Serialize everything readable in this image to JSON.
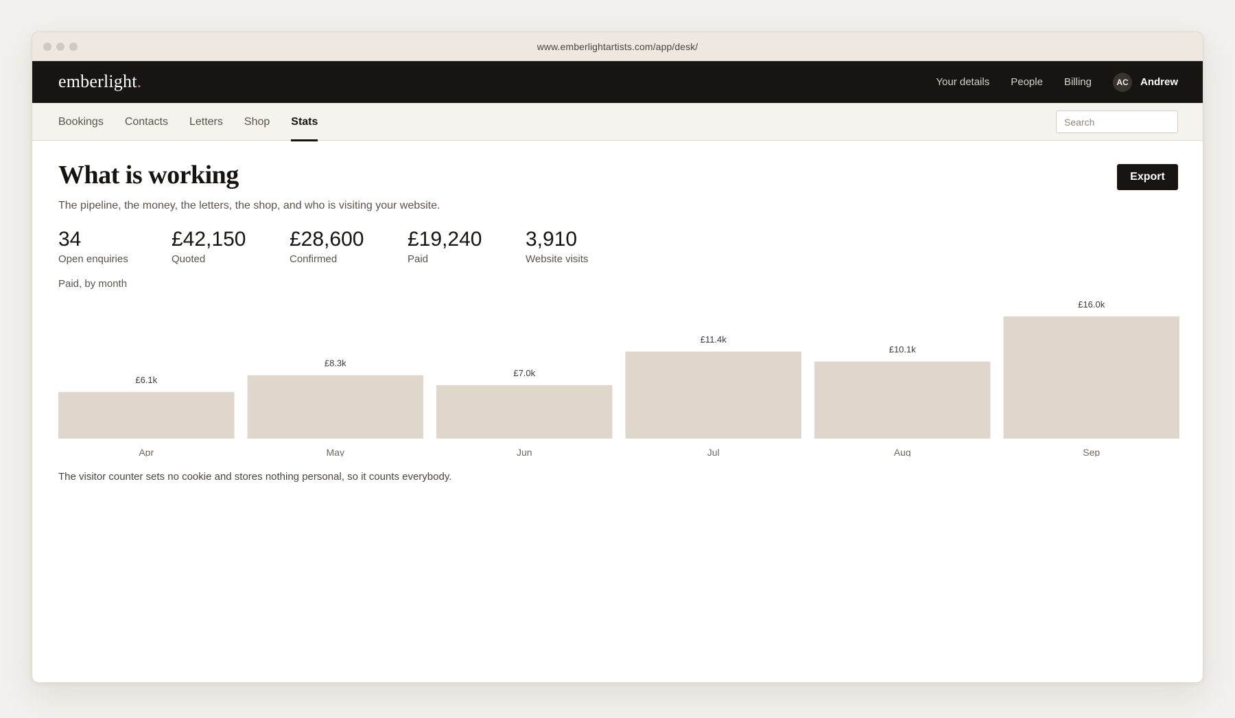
{
  "browser": {
    "url": "www.emberlightartists.com/app/desk/"
  },
  "topbar": {
    "logo": "emberlight",
    "logo_dot": ".",
    "links": [
      "Your details",
      "People",
      "Billing"
    ],
    "user": {
      "initials": "AC",
      "name": "Andrew"
    }
  },
  "subnav": {
    "tabs": [
      "Bookings",
      "Contacts",
      "Letters",
      "Shop",
      "Stats"
    ],
    "active_tab": "Stats",
    "search_placeholder": "Search"
  },
  "page": {
    "title": "What is working",
    "subtitle": "The pipeline, the money, the letters, the shop, and who is visiting your website.",
    "export_label": "Export",
    "stats": [
      {
        "value": "34",
        "label": "Open enquiries"
      },
      {
        "value": "£42,150",
        "label": "Quoted"
      },
      {
        "value": "£28,600",
        "label": "Confirmed"
      },
      {
        "value": "£19,240",
        "label": "Paid"
      },
      {
        "value": "3,910",
        "label": "Website visits"
      }
    ],
    "chart_title": "Paid, by month",
    "footnote": "The visitor counter sets no cookie and stores nothing personal, so it counts everybody."
  },
  "colors": {
    "bar": "#e0d7cc",
    "dark": "#171411",
    "muted": "#5a534b"
  },
  "chart_data": {
    "type": "bar",
    "title": "Paid, by month",
    "categories": [
      "Apr",
      "May",
      "Jun",
      "Jul",
      "Aug",
      "Sep"
    ],
    "values": [
      6.1,
      8.3,
      7.0,
      11.4,
      10.1,
      16.0
    ],
    "value_labels": [
      "£6.1k",
      "£8.3k",
      "£7.0k",
      "£11.4k",
      "£10.1k",
      "£16.0k"
    ],
    "unit": "£k",
    "ylim": [
      0,
      16.0
    ],
    "grid": false
  }
}
